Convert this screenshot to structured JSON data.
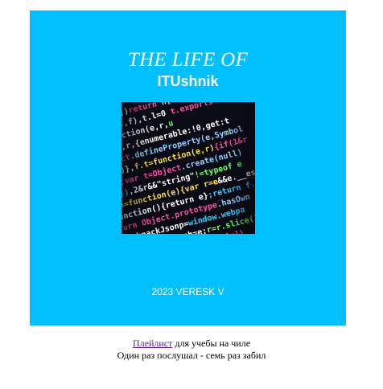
{
  "cover": {
    "title_top": "THE LIFE OF",
    "title_bottom": "ITUshnik",
    "credit": "2023 VERESK V",
    "background_color": "#00bfff",
    "image_icon": "code-screenshot"
  },
  "caption": {
    "playlist_link": "Плейлист",
    "line1_rest": " для учебы на чиле",
    "line2": "Один раз послушал - семь раз забил"
  }
}
